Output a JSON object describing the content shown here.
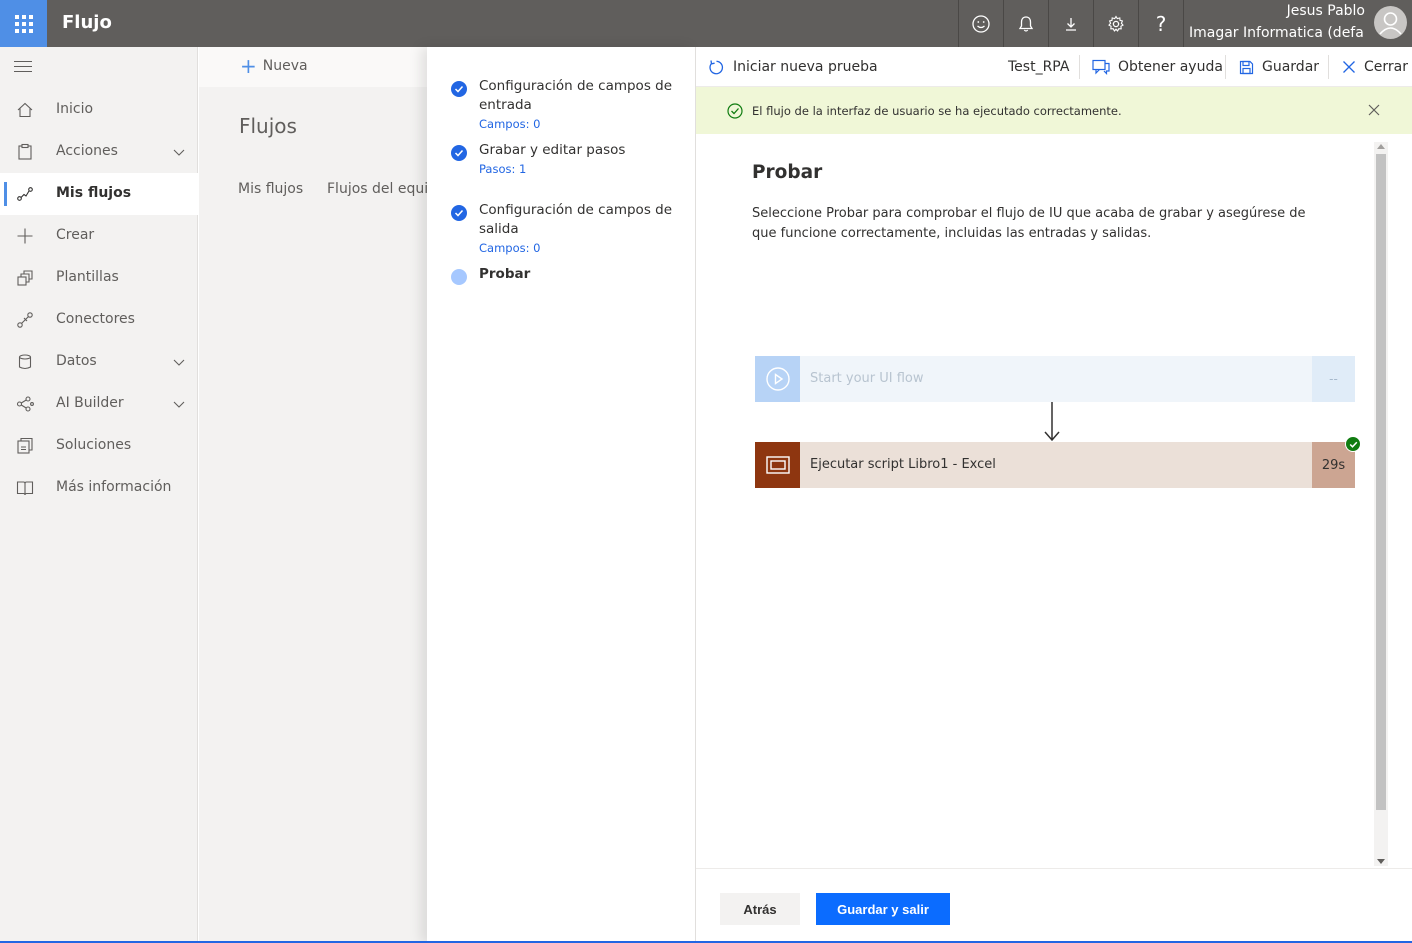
{
  "topbar": {
    "app_title": "Flujo",
    "user_name": "Jesus Pablo",
    "user_tenant": "Imagar Informatica (defau",
    "icons": [
      "smiley-icon",
      "bell-icon",
      "download-icon",
      "gear-icon",
      "help-icon"
    ],
    "help_glyph": "?"
  },
  "leftnav": {
    "items": [
      {
        "label": "Inicio",
        "icon": "home-icon"
      },
      {
        "label": "Acciones",
        "icon": "clipboard-icon",
        "expandable": true
      },
      {
        "label": "Mis flujos",
        "icon": "flow-icon",
        "active": true
      },
      {
        "label": "Crear",
        "icon": "plus-icon"
      },
      {
        "label": "Plantillas",
        "icon": "templates-icon"
      },
      {
        "label": "Conectores",
        "icon": "connector-icon"
      },
      {
        "label": "Datos",
        "icon": "database-icon",
        "expandable": true
      },
      {
        "label": "AI Builder",
        "icon": "ai-icon",
        "expandable": true
      },
      {
        "label": "Soluciones",
        "icon": "solutions-icon"
      },
      {
        "label": "Más información",
        "icon": "book-icon"
      }
    ]
  },
  "main": {
    "new_label": "Nueva",
    "page_title": "Flujos",
    "tabs": [
      "Mis flujos",
      "Flujos del equipo"
    ]
  },
  "stepper": {
    "steps": [
      {
        "title": "Configuración de campos de entrada",
        "sub": "Campos: 0",
        "state": "done"
      },
      {
        "title": "Grabar y editar pasos",
        "sub": "Pasos: 1",
        "state": "done"
      },
      {
        "title": "Configuración de campos de salida",
        "sub": "Campos: 0",
        "state": "done"
      },
      {
        "title": "Probar",
        "sub": "",
        "state": "current"
      }
    ]
  },
  "panel": {
    "toolbar": {
      "new_test": "Iniciar nueva prueba",
      "flow_name": "Test_RPA",
      "help": "Obtener ayuda",
      "save": "Guardar",
      "close": "Cerrar"
    },
    "banner": "El flujo de la interfaz de usuario se ha ejecutado correctamente.",
    "title": "Probar",
    "description": "Seleccione Probar para comprobar el flujo de IU que acaba de grabar y asegúrese de que funcione correctamente, incluidas las entradas y salidas.",
    "flow": {
      "start_label": "Start your UI flow",
      "start_duration": "--",
      "step_label": "Ejecutar script Libro1 - Excel",
      "step_duration": "29s"
    },
    "footer": {
      "back": "Atrás",
      "save_exit": "Guardar y salir"
    }
  },
  "colors": {
    "accent": "#2266e3",
    "primary_button": "#0b6cff",
    "banner_bg": "#f0f7d7",
    "success": "#107c10",
    "excel_step": "#8e3610"
  }
}
